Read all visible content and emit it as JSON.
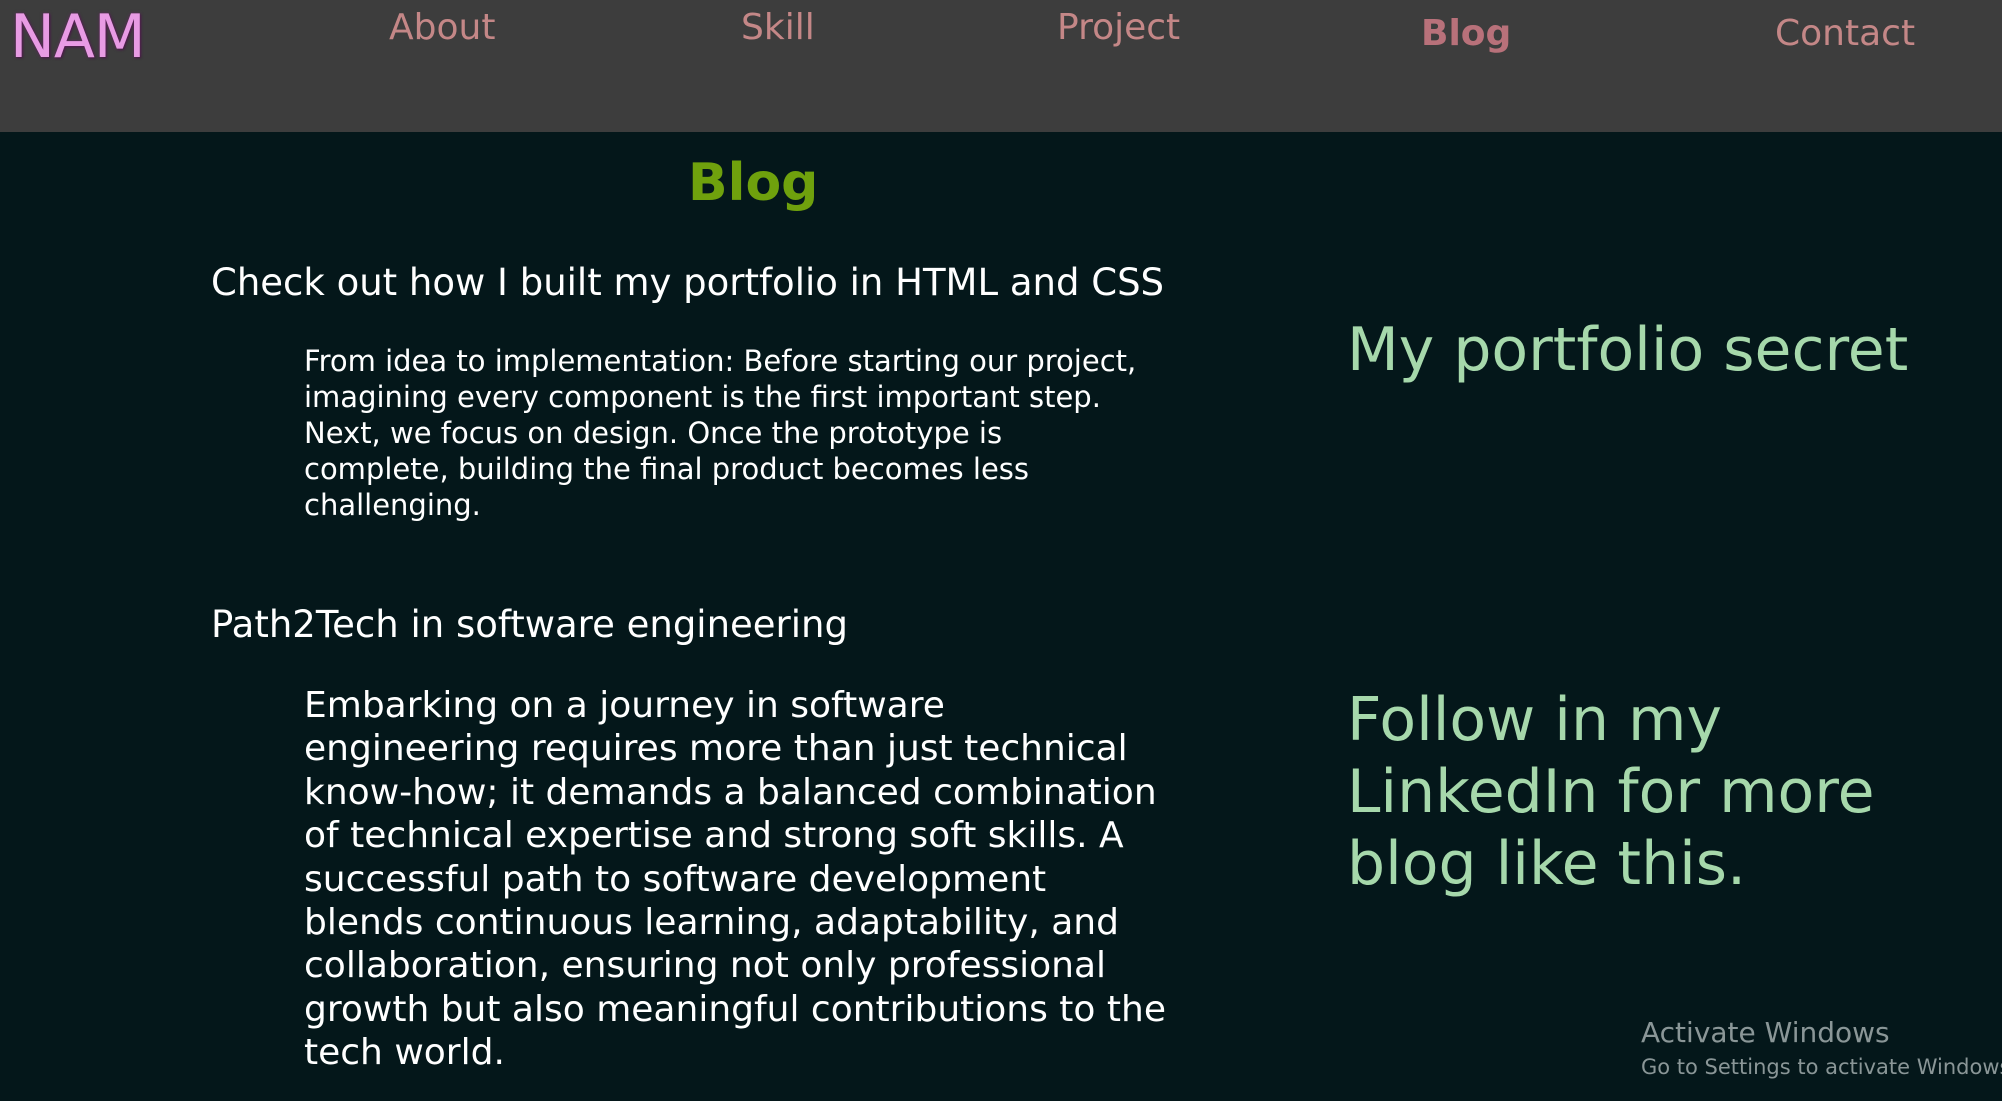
{
  "nav": {
    "logo": "NAM",
    "links": [
      {
        "label": "About"
      },
      {
        "label": "Skill"
      },
      {
        "label": "Project"
      },
      {
        "label": "Blog"
      },
      {
        "label": "Contact"
      }
    ],
    "active": "Blog"
  },
  "main": {
    "heading": "Blog",
    "posts": [
      {
        "title": "Check out how I built my portfolio in HTML and CSS",
        "body": "From idea to implementation: Before starting our project, imagining every component is the first important step. Next, we focus on design. Once the prototype is complete, building the final product becomes less challenging."
      },
      {
        "title": "Path2Tech in software engineering",
        "body": "Embarking on a journey in software engineering requires more than just technical know-how; it demands a balanced combination of technical expertise and strong soft skills. A successful path to software development blends continuous learning, adaptability, and collaboration, ensuring not only professional growth but also meaningful contributions to the tech world."
      }
    ]
  },
  "aside": {
    "secret": "My portfolio secret",
    "follow": "Follow in my LinkedIn for more blog like this."
  },
  "os_watermark": {
    "title": "Activate Windows",
    "subtitle": "Go to Settings to activate Windows."
  },
  "colors": {
    "navbar_bg": "#3d3d3d",
    "page_bg": "#04171a",
    "logo": "#e89be4",
    "nav_link": "#c48787",
    "heading": "#6fa10d",
    "body_text": "#ffffff",
    "aside_text": "#a6d8ab"
  }
}
